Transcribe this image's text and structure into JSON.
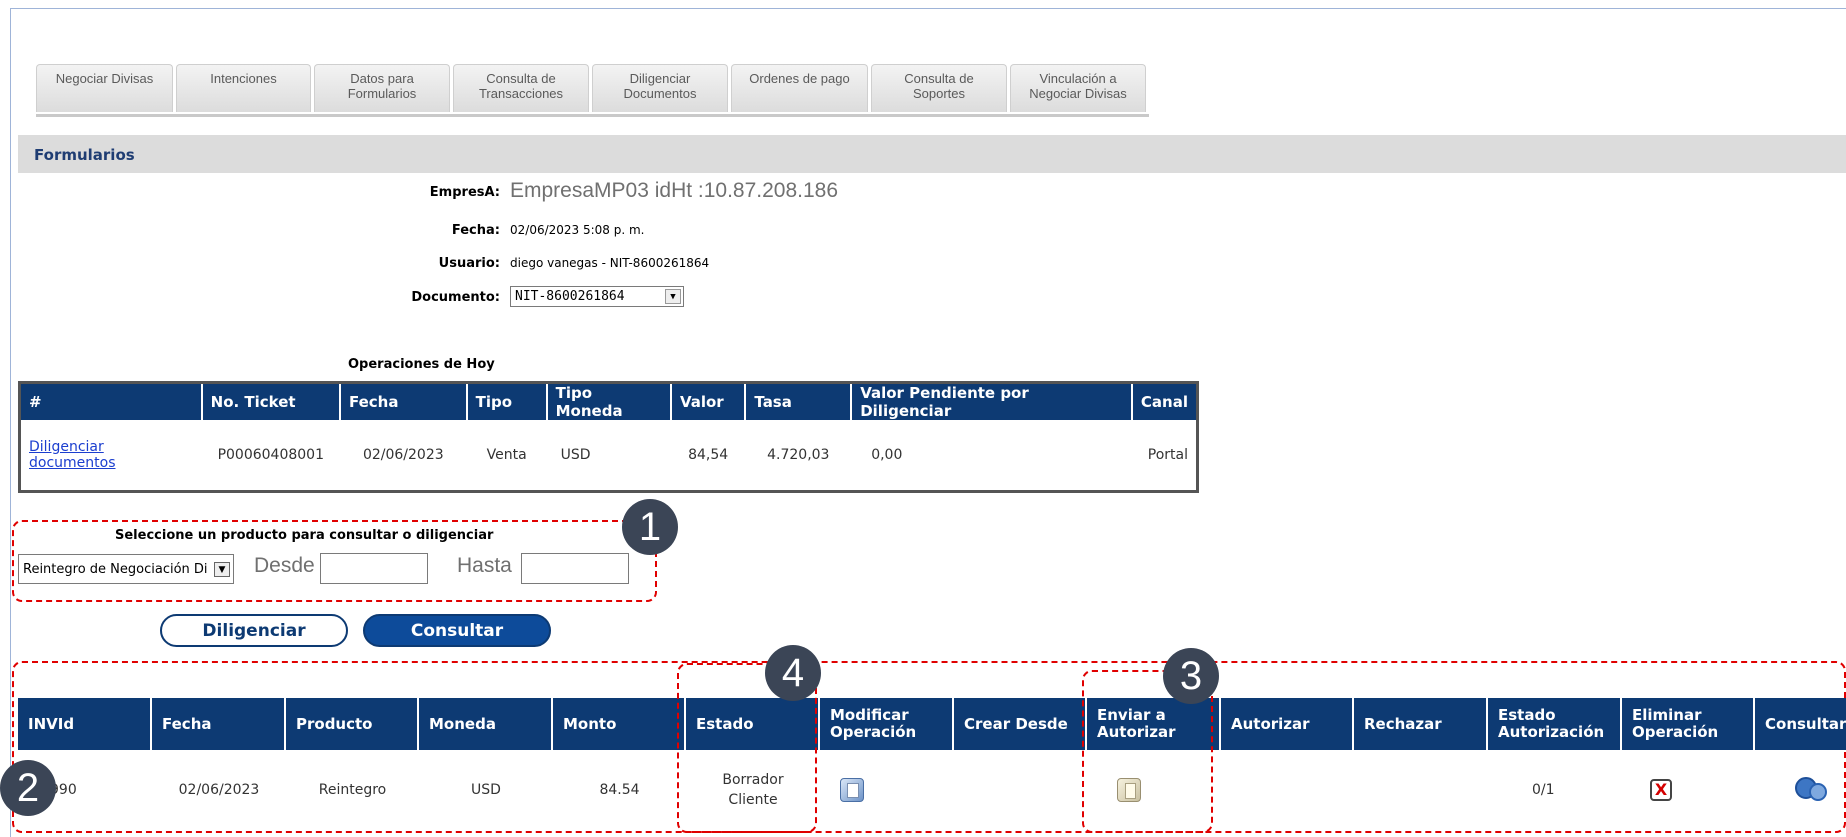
{
  "tabs": [
    "Negociar Divisas",
    "Intenciones",
    "Datos para\nFormularios",
    "Consulta de\nTransacciones",
    "Diligenciar\nDocumentos",
    "Ordenes de pago",
    "Consulta de\nSoportes",
    "Vinculación a\nNegociar Divisas"
  ],
  "section_title": "Formularios",
  "info": {
    "empresa_label": "EmpresA:",
    "empresa_value": "EmpresaMP03 idHt :10.87.208.186",
    "fecha_label": "Fecha:",
    "fecha_value": "02/06/2023 5:08 p. m.",
    "usuario_label": "Usuario:",
    "usuario_value": "diego vanegas - NIT-8600261864",
    "documento_label": "Documento:",
    "documento_value": "NIT-8600261864"
  },
  "ops": {
    "title": "Operaciones de Hoy",
    "headers": [
      "#",
      "No. Ticket",
      "Fecha",
      "Tipo",
      "Tipo Moneda",
      "Valor",
      "Tasa",
      "Valor Pendiente por Diligenciar",
      "Canal"
    ],
    "row": {
      "link": "Diligenciar documentos",
      "ticket": "P00060408001",
      "fecha": "02/06/2023",
      "tipo": "Venta",
      "moneda": "USD",
      "valor": "84,54",
      "tasa": "4.720,03",
      "pendiente": "0,00",
      "canal": "Portal"
    }
  },
  "product": {
    "title": "Seleccione un producto para consultar o diligenciar",
    "selected": "Reintegro de Negociación Di",
    "desde_label": "Desde",
    "hasta_label": "Hasta"
  },
  "buttons": {
    "diligenciar": "Diligenciar",
    "consultar": "Consultar"
  },
  "results": {
    "headers": {
      "invid": "INVId",
      "fecha": "Fecha",
      "producto": "Producto",
      "moneda": "Moneda",
      "monto": "Monto",
      "estado": "Estado",
      "modificar": "Modificar Operación",
      "crear": "Crear Desde",
      "enviar": "Enviar a Autorizar",
      "autorizar": "Autorizar",
      "rechazar": "Rechazar",
      "estado_aut": "Estado Autorización",
      "eliminar": "Eliminar Operación",
      "consultar": "Consultar"
    },
    "row": {
      "invid": "990",
      "fecha": "02/06/2023",
      "producto": "Reintegro",
      "moneda": "USD",
      "monto": "84.54",
      "estado": "Borrador Cliente",
      "estado_aut": "0/1",
      "delete_glyph": "X"
    }
  },
  "badges": [
    "1",
    "2",
    "3",
    "4"
  ],
  "icons": {
    "modificar": "edit-icon",
    "enviar": "send-document-icon",
    "eliminar": "delete-icon",
    "consultar": "search-icon",
    "dropdown": "chevron-down-icon"
  },
  "colors": {
    "header_navy": "#0d3a73",
    "annotation_red": "#e00000",
    "badge": "#3b4556",
    "link_blue": "#1b3ecf"
  }
}
